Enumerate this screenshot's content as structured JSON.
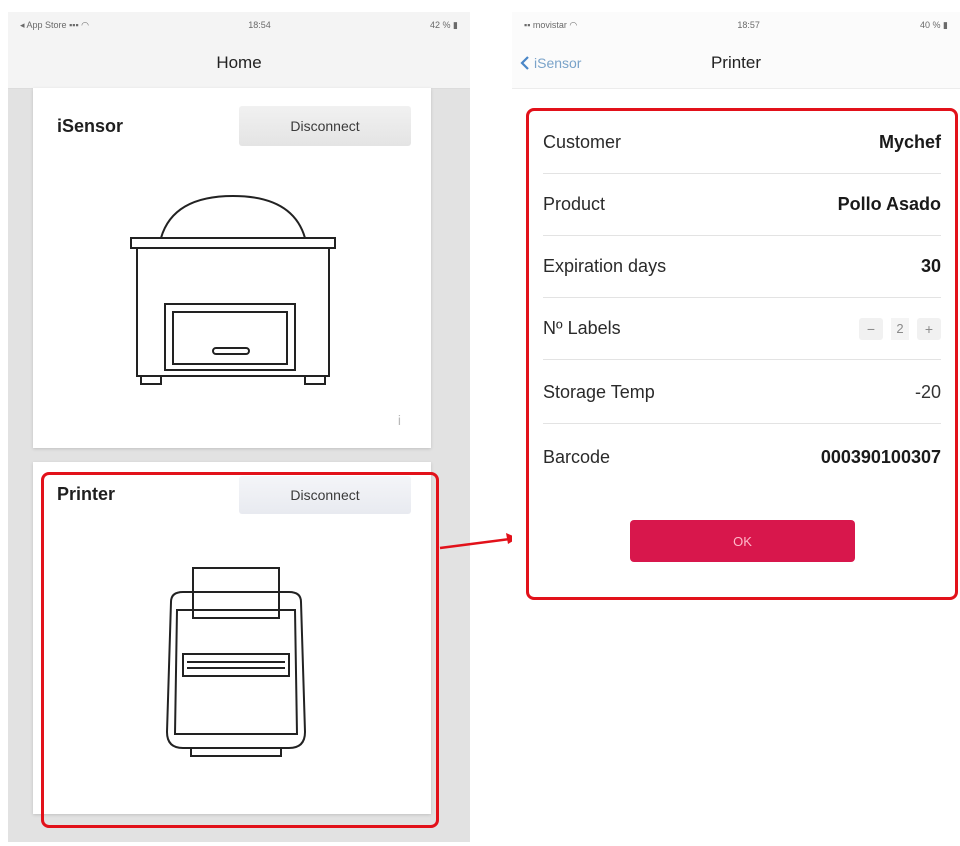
{
  "left_screen": {
    "status": {
      "carrier": "App Store",
      "time": "18:54",
      "battery": "42 %"
    },
    "title": "Home",
    "cards": [
      {
        "name": "iSensor",
        "button": "Disconnect",
        "info": "i"
      },
      {
        "name": "Printer",
        "button": "Disconnect"
      }
    ]
  },
  "right_screen": {
    "status": {
      "carrier": "movistar",
      "time": "18:57",
      "battery": "40 %"
    },
    "back_label": "iSensor",
    "title": "Printer",
    "rows": [
      {
        "label": "Customer",
        "value": "Mychef"
      },
      {
        "label": "Product",
        "value": "Pollo Asado"
      },
      {
        "label": "Expiration days",
        "value": "30"
      },
      {
        "label": "Nº Labels",
        "value": "2",
        "minus": "−",
        "plus": "+"
      },
      {
        "label": "Storage Temp",
        "value": "-20"
      },
      {
        "label": "Barcode",
        "value": "000390100307"
      }
    ],
    "ok_label": "OK"
  },
  "colors": {
    "highlight": "#e2111a",
    "ok_button": "#d8174c",
    "back_link": "#7aa3c9"
  },
  "icons": [
    "chevron-left-icon",
    "wifi-icon",
    "battery-icon",
    "signal-icon",
    "info-icon",
    "arrow-right-icon",
    "vacuum-sealer-illustration",
    "label-printer-illustration"
  ]
}
